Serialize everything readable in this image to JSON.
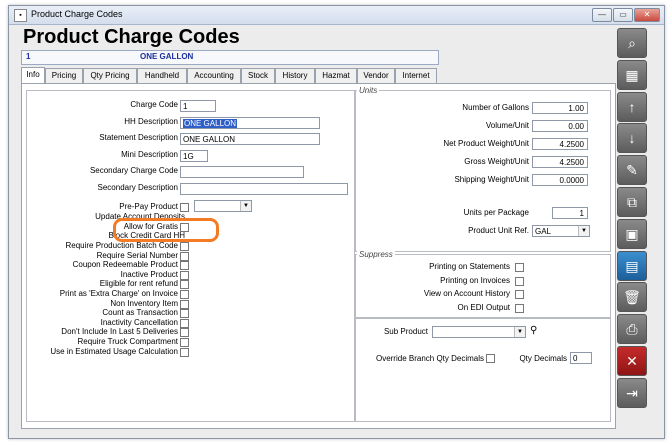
{
  "window": {
    "title": "Product Charge Codes",
    "minimize": "—",
    "restore": "▭",
    "close": "✕"
  },
  "header": {
    "title": "Product Charge Codes"
  },
  "record": {
    "code": "1",
    "name": "ONE GALLON"
  },
  "tabs": [
    "Info",
    "Pricing",
    "Qty Pricing",
    "Handheld",
    "Accounting",
    "Stock",
    "History",
    "Hazmat",
    "Vendor",
    "Internet"
  ],
  "left": {
    "charge_code_label": "Charge Code",
    "charge_code": "1",
    "hh_desc_label": "HH Description",
    "hh_desc": "ONE GALLON",
    "stmt_desc_label": "Statement Description",
    "stmt_desc": "ONE GALLON",
    "mini_desc_label": "Mini Description",
    "mini_desc": "1G",
    "sec_code_label": "Secondary Charge Code",
    "sec_code": "",
    "sec_desc_label": "Secondary Description",
    "sec_desc": "",
    "prepay_label": "Pre-Pay Product",
    "update_label": "Update Account Deposits",
    "gratis_label": "Allow for Gratis",
    "block_label": "Block Credit Card HH"
  },
  "checkboxes": [
    "Require Production Batch Code",
    "Require Serial Number",
    "Coupon Redeemable Product",
    "Inactive Product",
    "Eligible for rent refund",
    "Print as 'Extra Charge' on Invoice",
    "Non Inventory Item",
    "Count as Transaction",
    "Inactivity Cancellation",
    "Don't Include In Last 5 Deliveries",
    "Require Truck Compartment",
    "Use in Estimated Usage Calculation"
  ],
  "units": {
    "group_label": "Units",
    "rows": [
      {
        "label": "Number of Gallons",
        "value": "1.00"
      },
      {
        "label": "Volume/Unit",
        "value": "0.00"
      },
      {
        "label": "Net Product Weight/Unit",
        "value": "4.2500"
      },
      {
        "label": "Gross Weight/Unit",
        "value": "4.2500"
      },
      {
        "label": "Shipping Weight/Unit",
        "value": "0.0000"
      }
    ],
    "upp_label": "Units per Package",
    "upp": "1",
    "unit_ref_label": "Product Unit Ref.",
    "unit_ref": "GAL"
  },
  "suppress": {
    "group_label": "Suppress",
    "items": [
      "Printing on Statements",
      "Printing on Invoices",
      "View on Account History",
      "On EDI Output"
    ]
  },
  "sub": {
    "sub_product_label": "Sub Product",
    "sub_product": "",
    "override_label": "Override Branch Qty Decimals",
    "qty_dec_label": "Qty Decimals",
    "qty_dec": "0"
  },
  "toolbar": [
    {
      "name": "search-icon",
      "glyph": "⌕"
    },
    {
      "name": "grid-icon",
      "glyph": "▦"
    },
    {
      "name": "arrow-up-icon",
      "glyph": "↑"
    },
    {
      "name": "arrow-down-icon",
      "glyph": "↓"
    },
    {
      "name": "edit-pencil-icon",
      "glyph": "✎"
    },
    {
      "name": "copy-add-icon",
      "glyph": "⧉"
    },
    {
      "name": "new-record-icon",
      "glyph": "▣"
    },
    {
      "name": "save-disk-icon",
      "glyph": "▤"
    },
    {
      "name": "trash-icon",
      "glyph": "🗑"
    },
    {
      "name": "print-icon",
      "glyph": "⎙"
    },
    {
      "name": "cancel-x-icon",
      "glyph": "✕"
    },
    {
      "name": "exit-door-icon",
      "glyph": "⇥"
    }
  ],
  "colors": {
    "accent": "#1a2fa0",
    "highlight": "#f47a24",
    "selection": "#2e5fc9"
  }
}
